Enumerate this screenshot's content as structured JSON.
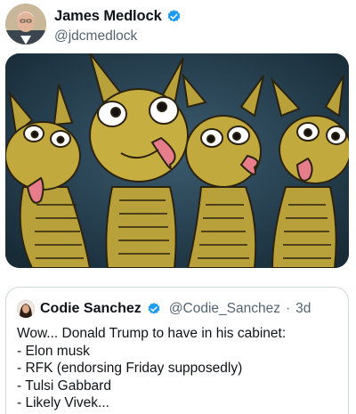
{
  "author": {
    "display_name": "James Medlock",
    "handle": "@jdcmedlock",
    "avatar_icon": "profile-photo-avatar",
    "verified_icon": "verified-badge-icon"
  },
  "media": {
    "image_icon": "three-headed-dragon-meme-image"
  },
  "quoted_post": {
    "display_name": "Codie Sanchez",
    "handle": "@Codie_Sanchez",
    "separator": "·",
    "time": "3d",
    "lines": [
      "Wow... Donald Trump to have in his cabinet:",
      "- Elon musk",
      "- RFK (endorsing Friday supposedly)",
      "- Tulsi Gabbard",
      "- Likely Vivek..."
    ]
  },
  "colors": {
    "verified_blue": "#1d9bf0",
    "secondary_text": "#536471",
    "border": "#cfd9de"
  }
}
